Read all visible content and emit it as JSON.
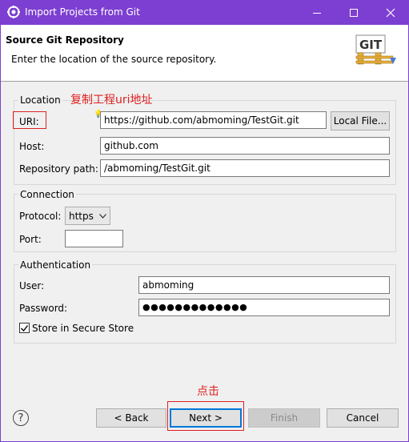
{
  "window": {
    "title": "Import Projects from Git"
  },
  "header": {
    "title": "Source Git Repository",
    "description": "Enter the location of the source repository.",
    "logo_text": "GIT"
  },
  "location": {
    "legend": "Location",
    "uri_label": "URI:",
    "uri_value": "https://github.com/abmoming/TestGit.git",
    "local_file_button": "Local File...",
    "host_label": "Host:",
    "host_value": "github.com",
    "repo_path_label": "Repository path:",
    "repo_path_value": "/abmoming/TestGit.git"
  },
  "connection": {
    "legend": "Connection",
    "protocol_label": "Protocol:",
    "protocol_value": "https",
    "port_label": "Port:",
    "port_value": ""
  },
  "authentication": {
    "legend": "Authentication",
    "user_label": "User:",
    "user_value": "abmoming",
    "password_label": "Password:",
    "password_value": "●●●●●●●●●●●●●",
    "store_label": "Store in Secure Store",
    "store_checked": true
  },
  "annotations": {
    "uri_note": "复制工程uri地址",
    "click_note": "点击"
  },
  "footer": {
    "back_button": "< Back",
    "next_button": "Next >",
    "finish_button": "Finish",
    "cancel_button": "Cancel"
  },
  "colors": {
    "titlebar": "#7d3fd1",
    "annotation": "#e02020",
    "default_button_border": "#0078d7"
  },
  "icons": {
    "title": "eclipse-icon",
    "help": "help-icon",
    "select_arrow": "chevron-down-icon"
  }
}
